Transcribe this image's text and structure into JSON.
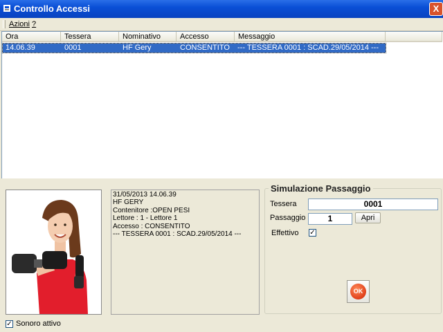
{
  "window": {
    "title": "Controllo Accessi",
    "close_glyph": "X"
  },
  "menu": {
    "items": [
      {
        "label": "Azioni"
      },
      {
        "label": "?"
      }
    ]
  },
  "access_log": {
    "columns": [
      "Ora",
      "Tessera",
      "Nominativo",
      "Accesso",
      "Messaggio"
    ],
    "rows": [
      {
        "ora": "14.06.39",
        "tessera": "0001",
        "nominativo": "HF  Gery",
        "accesso": "CONSENTITO",
        "messaggio": "--- TESSERA 0001 :  SCAD.29/05/2014 ---"
      }
    ]
  },
  "detail": {
    "photo_icon": "member-photo",
    "lines": [
      "31/05/2013 14.06.39",
      "HF  GERY",
      "Contenitore :OPEN PESI",
      "Lettore : 1 - Lettore 1",
      "Accesso : CONSENTITO",
      "--- TESSERA 0001 :  SCAD.29/05/2014 ---"
    ]
  },
  "simulation": {
    "title": "Simulazione Passaggio",
    "tessera_label": "Tessera",
    "tessera_value": "0001",
    "passaggio_label": "Passaggio",
    "passaggio_value": "1",
    "apri_label": "Apri",
    "effettivo_label": "Effettivo",
    "effettivo_checked": true,
    "ok_label": "OK"
  },
  "footer": {
    "sonoro_label": "Sonoro attivo",
    "sonoro_checked": true
  },
  "colors": {
    "selection": "#316ac5",
    "titlebar": "#0a4fd6",
    "ok_button": "#e0401a"
  }
}
